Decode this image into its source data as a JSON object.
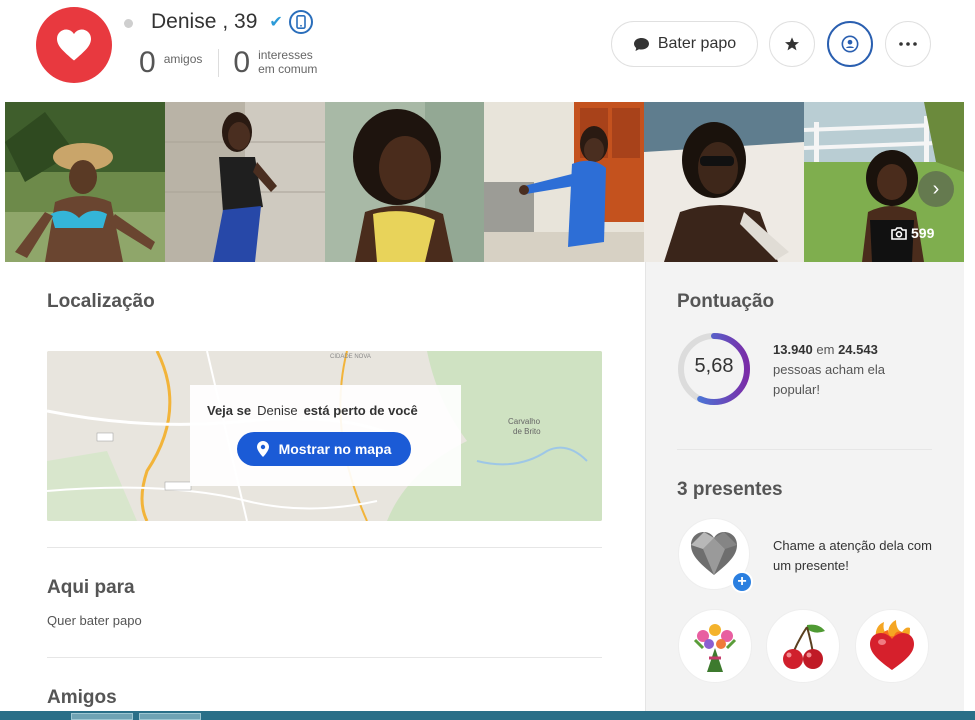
{
  "header": {
    "name": "Denise",
    "age": ", 39",
    "stats": {
      "friends_count": "0",
      "friends_label": "amigos",
      "interests_count": "0",
      "interests_label_1": "interesses",
      "interests_label_2": "em comum"
    },
    "chat_button": "Bater papo"
  },
  "photos": {
    "count": "599"
  },
  "location": {
    "title": "Localização",
    "map_text_prefix": "Veja se",
    "map_text_name": "Denise",
    "map_text_suffix": "está perto de você",
    "map_button": "Mostrar no mapa"
  },
  "here_for": {
    "title": "Aqui para",
    "value": "Quer bater papo"
  },
  "friends": {
    "title": "Amigos"
  },
  "score": {
    "title": "Pontuação",
    "value": "5,68",
    "fraction": 0.568,
    "rank": "13.940",
    "in_word": "em",
    "total": "24.543",
    "desc": "pessoas acham ela popular!"
  },
  "gifts": {
    "title": "3 presentes",
    "cta": "Chame a atenção dela com um presente!",
    "items": [
      "flower-bouquet-icon",
      "cherries-icon",
      "flaming-heart-icon"
    ]
  },
  "colors": {
    "brand": "#e8393f",
    "accent": "#1b5bd6",
    "verified": "#2d9bd8"
  }
}
